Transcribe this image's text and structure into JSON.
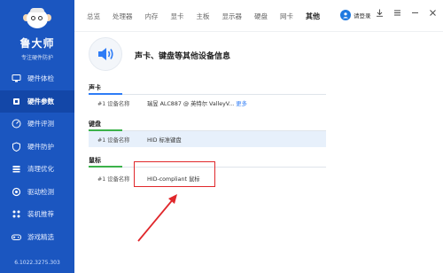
{
  "brand": {
    "name": "鲁大师",
    "subtitle": "专注硬件防护"
  },
  "sidebar": {
    "items": [
      {
        "label": "硬件体检",
        "icon": "monitor-check-icon"
      },
      {
        "label": "硬件参数",
        "icon": "chip-icon",
        "active": true
      },
      {
        "label": "硬件评测",
        "icon": "benchmark-icon"
      },
      {
        "label": "硬件防护",
        "icon": "shield-icon"
      },
      {
        "label": "清理优化",
        "icon": "broom-icon"
      },
      {
        "label": "驱动检测",
        "icon": "driver-icon"
      },
      {
        "label": "装机推荐",
        "icon": "pc-build-icon"
      },
      {
        "label": "游戏精选",
        "icon": "gamepad-icon"
      }
    ],
    "version": "6.1022.3275.303"
  },
  "topbar": {
    "tabs": [
      {
        "label": "总览"
      },
      {
        "label": "处理器"
      },
      {
        "label": "内存"
      },
      {
        "label": "显卡"
      },
      {
        "label": "主板"
      },
      {
        "label": "显示器"
      },
      {
        "label": "硬盘"
      },
      {
        "label": "网卡"
      },
      {
        "label": "其他",
        "active": true
      }
    ],
    "login_label": "请登录"
  },
  "section": {
    "title": "声卡、键盘等其他设备信息"
  },
  "groups": [
    {
      "title": "声卡",
      "rows": [
        {
          "key": "#1 设备名称",
          "value": "瑞昱 ALC887 @ 英特尔 ValleyV...",
          "more": "更多"
        }
      ]
    },
    {
      "title": "键盘",
      "rows": [
        {
          "key": "#1 设备名称",
          "value": "HID 标准键盘"
        }
      ]
    },
    {
      "title": "鼠标",
      "rows": [
        {
          "key": "#1 设备名称",
          "value": "HID-compliant 鼠标"
        }
      ]
    }
  ],
  "colors": {
    "sidebar_bg": "#1b56c0",
    "accent": "#2e7cf6",
    "annotation": "#e0272b"
  }
}
